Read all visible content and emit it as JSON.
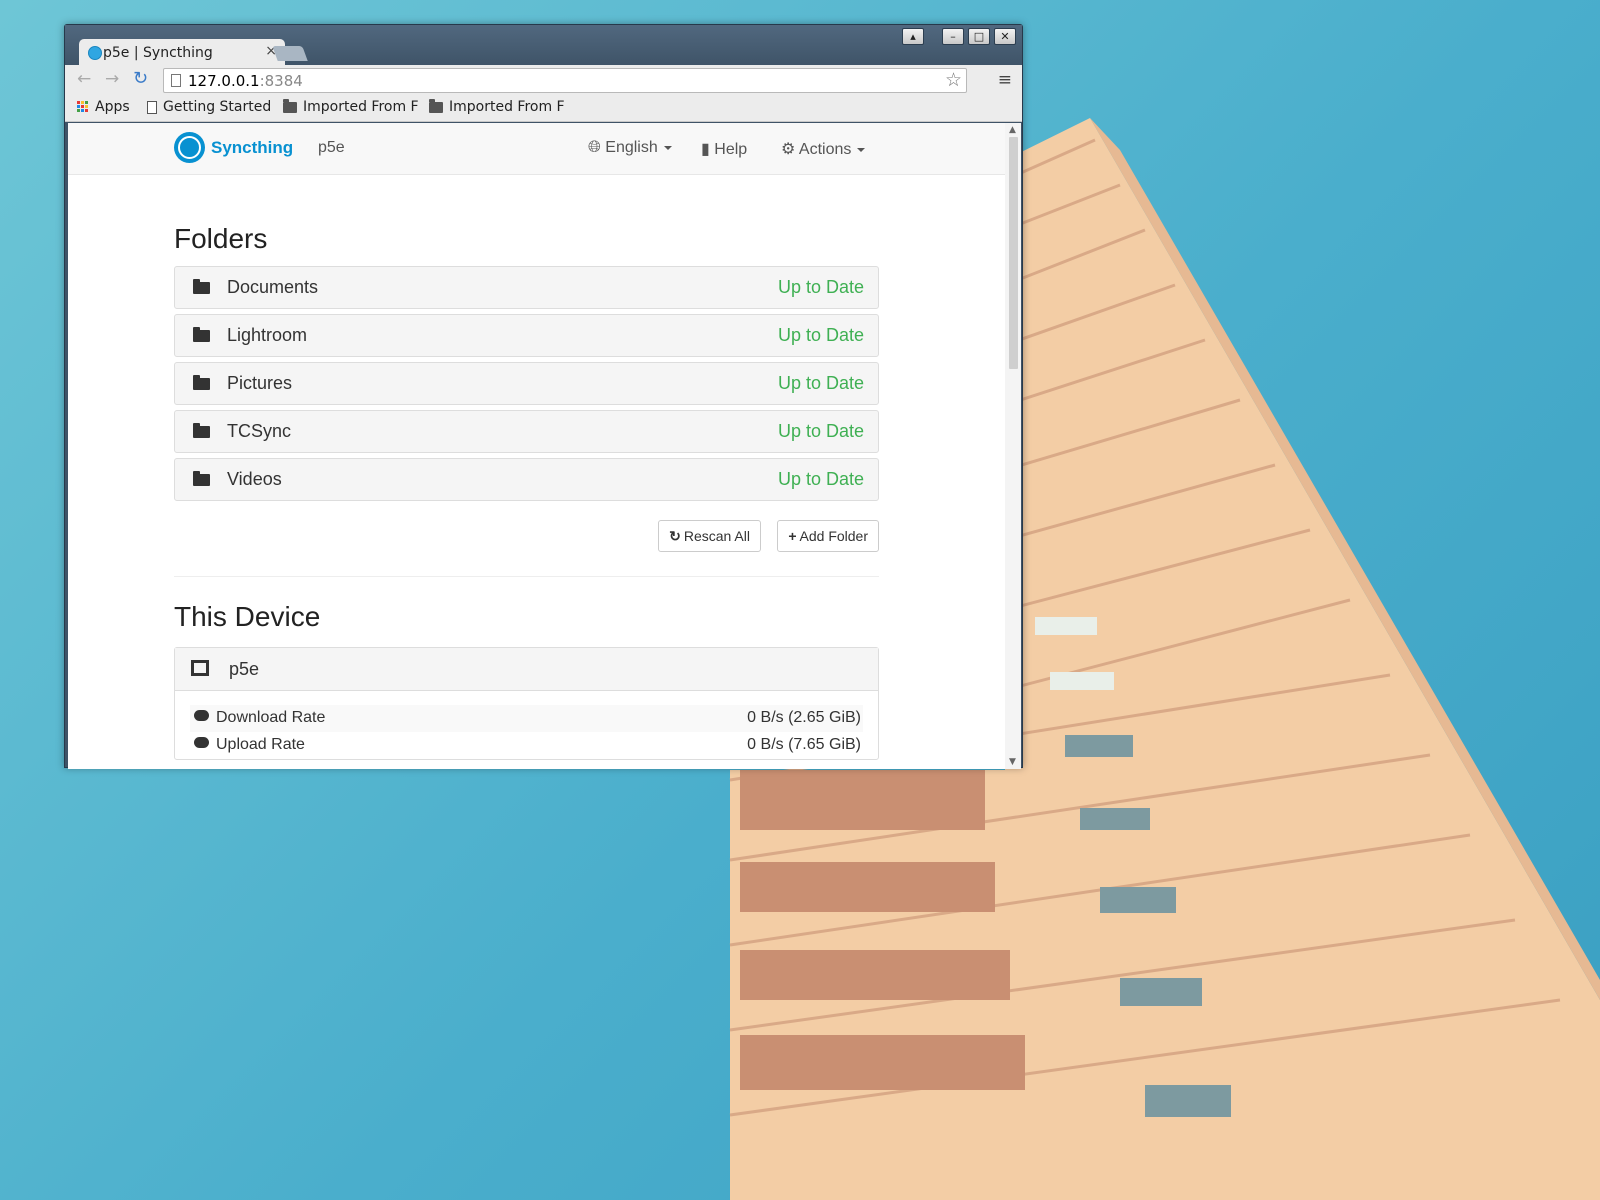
{
  "browser": {
    "tab_title": "p5e | Syncthing",
    "tab_close": "×",
    "url_host": "127.0.0.1",
    "url_port": ":8384",
    "bookmarks": [
      "Apps",
      "Getting Started",
      "Imported From F",
      "Imported From F"
    ]
  },
  "navbar": {
    "brand": "Syncthing",
    "device_name": "p5e",
    "language": "English",
    "help": "Help",
    "actions": "Actions"
  },
  "folders": {
    "title": "Folders",
    "items": [
      {
        "name": "Documents",
        "status": "Up to Date"
      },
      {
        "name": "Lightroom",
        "status": "Up to Date"
      },
      {
        "name": "Pictures",
        "status": "Up to Date"
      },
      {
        "name": "TCSync",
        "status": "Up to Date"
      },
      {
        "name": "Videos",
        "status": "Up to Date"
      }
    ],
    "rescan_all": "Rescan All",
    "add_folder": "Add Folder"
  },
  "this_device": {
    "title": "This Device",
    "name": "p5e",
    "download_label": "Download Rate",
    "download_value": "0 B/s (2.65 GiB)",
    "upload_label": "Upload Rate",
    "upload_value": "0 B/s (7.65 GiB)"
  },
  "colors": {
    "status_up_to_date": "#3fb053",
    "brand": "#0891d1"
  }
}
